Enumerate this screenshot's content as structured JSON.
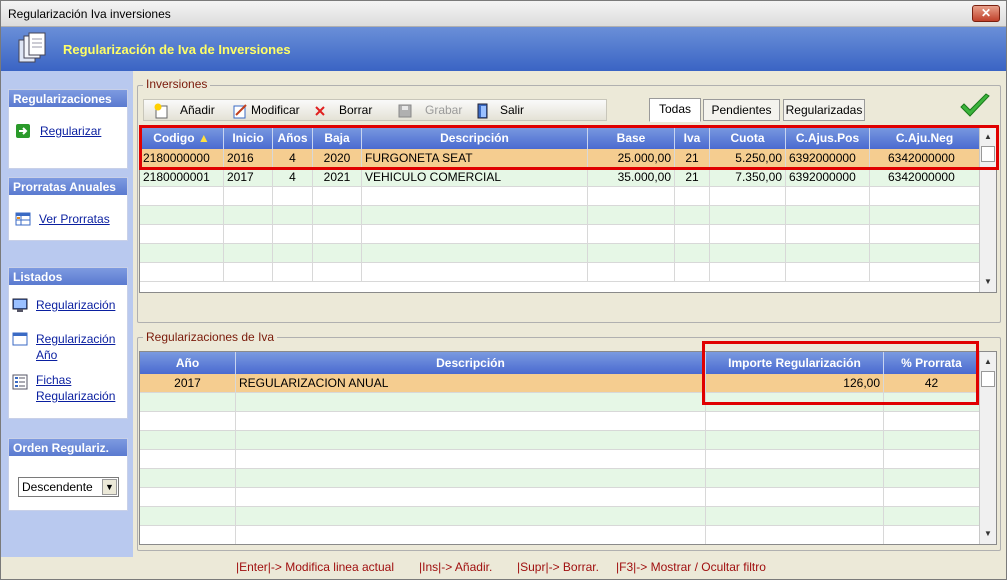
{
  "window": {
    "title": "Regularización Iva inversiones",
    "close_label": "✕"
  },
  "header": {
    "title": "Regularización de Iva de Inversiones"
  },
  "sidebar": {
    "regularizaciones": {
      "title": "Regularizaciones",
      "items": [
        {
          "label": "Regularizar"
        }
      ]
    },
    "prorratas": {
      "title": "Prorratas Anuales",
      "items": [
        {
          "label": "Ver Prorratas"
        }
      ]
    },
    "listados": {
      "title": "Listados",
      "items": [
        {
          "label": "Regularización"
        },
        {
          "label_line1": "Regularización",
          "label_line2": "Año"
        },
        {
          "label_line1": "Fichas",
          "label_line2": "Regularización"
        }
      ]
    },
    "orden": {
      "title": "Orden Regulariz.",
      "selected": "Descendente"
    }
  },
  "inversiones": {
    "legend": "Inversiones",
    "toolbar": {
      "add": "Añadir",
      "modify": "Modificar",
      "delete": "Borrar",
      "save": "Grabar",
      "exit": "Salir"
    },
    "tabs": [
      "Todas",
      "Pendientes",
      "Regularizadas"
    ],
    "columns": [
      "Codigo",
      "Inicio",
      "Años",
      "Baja",
      "Descripción",
      "Base",
      "Iva",
      "Cuota",
      "C.Ajus.Pos",
      "C.Aju.Neg"
    ],
    "rows": [
      [
        "2180000000",
        "2016",
        "4",
        "2020",
        "FURGONETA SEAT",
        "25.000,00",
        "21",
        "5.250,00",
        "6392000000",
        "6342000000"
      ],
      [
        "2180000001",
        "2017",
        "4",
        "2021",
        "VEHICULO COMERCIAL",
        "35.000,00",
        "21",
        "7.350,00",
        "6392000000",
        "6342000000"
      ]
    ],
    "sort_indicator": "▲"
  },
  "regularizaciones_iva": {
    "legend": "Regularizaciones de Iva",
    "columns": [
      "Año",
      "Descripción",
      "Importe Regularización",
      "% Prorrata"
    ],
    "rows": [
      [
        "2017",
        "REGULARIZACION ANUAL",
        "126,00",
        "42"
      ]
    ]
  },
  "statusbar": {
    "items": [
      "|Enter|-> Modifica linea actual",
      "|Ins|-> Añadir.",
      "|Supr|-> Borrar.",
      "|F3|-> Mostrar / Ocultar filtro"
    ]
  },
  "colors": {
    "selected_row": "#f5cd90",
    "alt_row": "#e6f7e6",
    "highlight_box": "#e00000",
    "header_blue": "#4a6ad0"
  }
}
